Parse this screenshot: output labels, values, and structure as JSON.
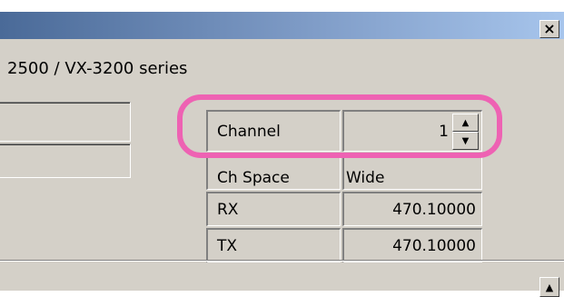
{
  "window": {
    "close_glyph": "×",
    "series_title": "2500 / VX-3200 series"
  },
  "fields": [
    {
      "label": "Channel",
      "value": "1"
    },
    {
      "label": "Ch Space",
      "value": "Wide"
    },
    {
      "label": "RX",
      "value": "470.10000"
    },
    {
      "label": "TX",
      "value": "470.10000"
    }
  ],
  "spinner": {
    "up_glyph": "▲",
    "down_glyph": "▼"
  },
  "scroll": {
    "up_glyph": "▲"
  },
  "colors": {
    "highlight": "#ee62b3",
    "window_bg": "#d4d0c8",
    "titlebar_start": "#4a6a98",
    "titlebar_end": "#a7c5ec"
  }
}
